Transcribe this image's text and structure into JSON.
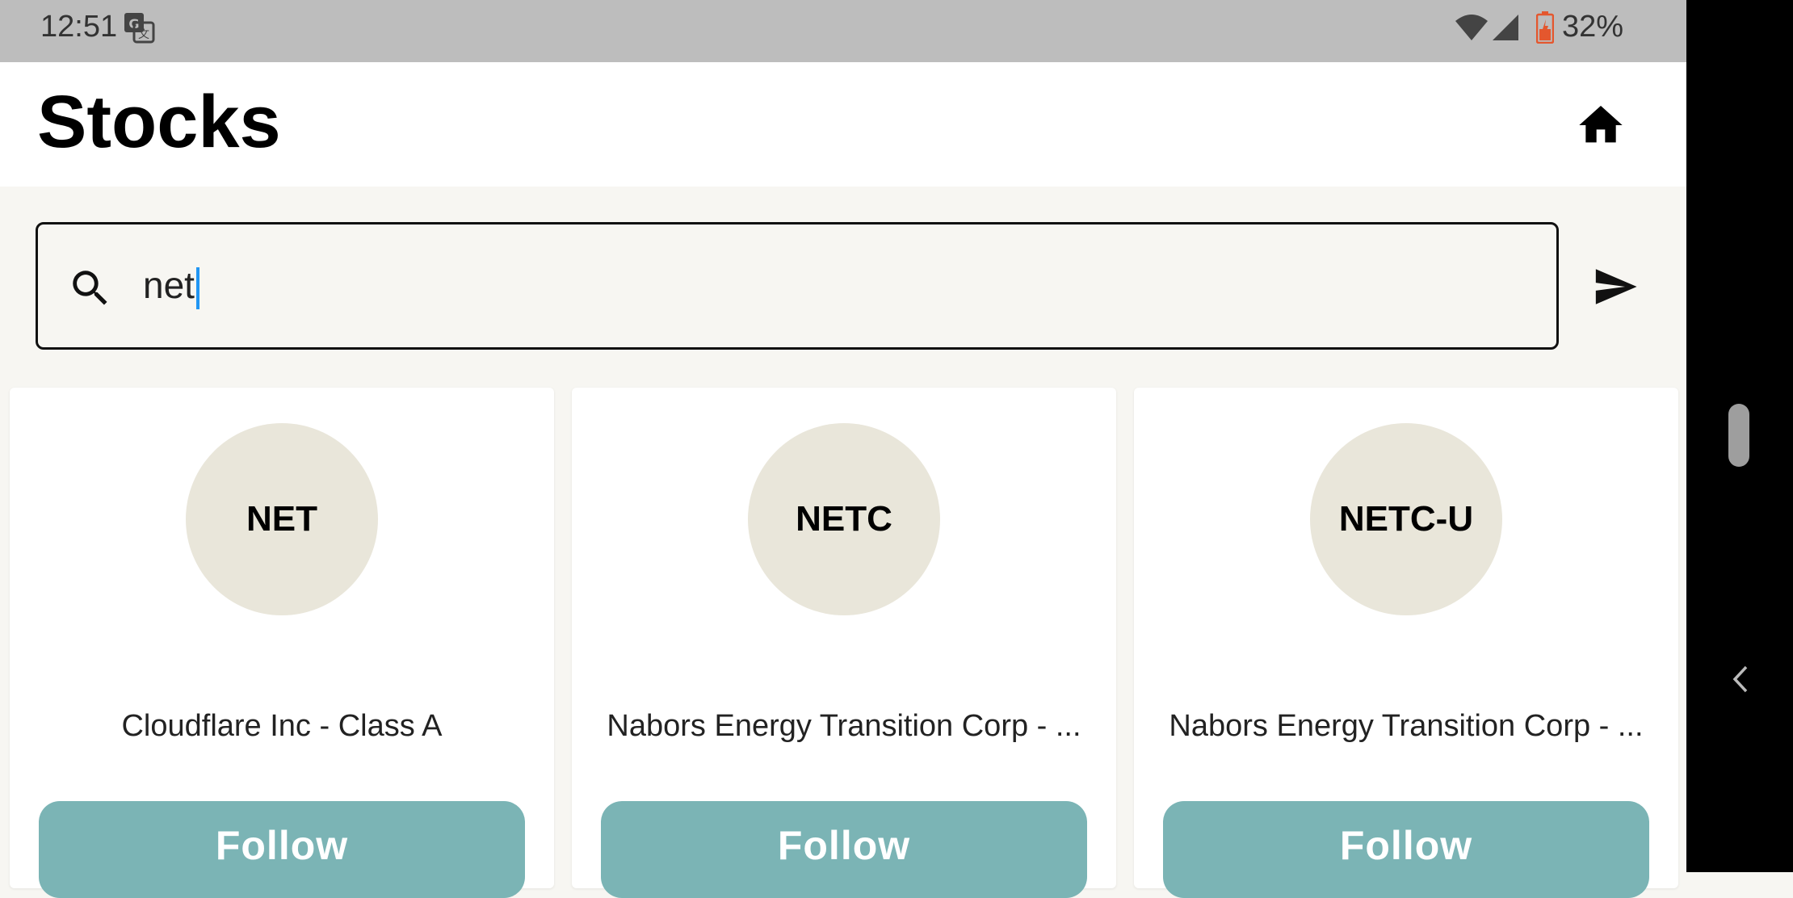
{
  "status_bar": {
    "time": "12:51",
    "battery": "32%",
    "icons": [
      "translate-icon",
      "wifi-icon",
      "signal-icon",
      "battery-icon"
    ]
  },
  "header": {
    "title": "Stocks",
    "home_icon": "home-icon"
  },
  "search": {
    "value": "net",
    "icon": "search-icon",
    "send_icon": "send-icon"
  },
  "results": [
    {
      "symbol": "NET",
      "name": "Cloudflare Inc - Class A",
      "button": "Follow"
    },
    {
      "symbol": "NETC",
      "name": "Nabors Energy Transition Corp - ...",
      "button": "Follow"
    },
    {
      "symbol": "NETC-U",
      "name": "Nabors Energy Transition Corp - ...",
      "button": "Follow"
    }
  ],
  "colors": {
    "follow_button": "#7bb4b5",
    "avatar_bg": "#e9e6da",
    "page_bg": "#f7f6f2",
    "caret": "#2196f3"
  }
}
